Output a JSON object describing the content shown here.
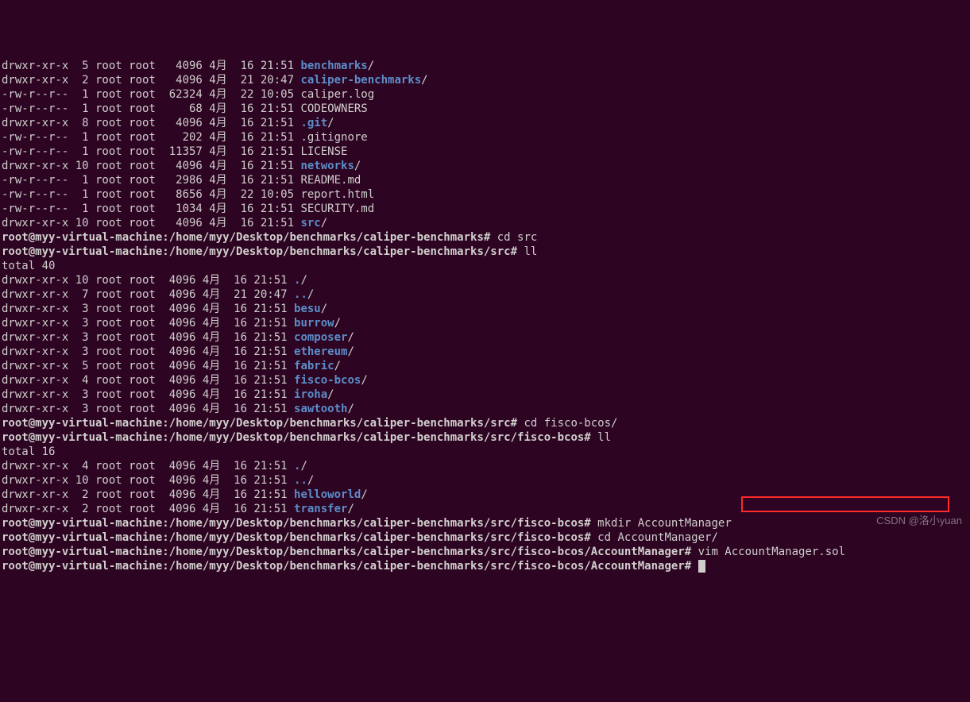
{
  "listing1": [
    {
      "perm": "drwxr-xr-x",
      "ln": " 5",
      "own": "root root",
      "size": "  4096",
      "date": "4月  16 21:51",
      "name": "benchmarks",
      "type": "dir"
    },
    {
      "perm": "drwxr-xr-x",
      "ln": " 2",
      "own": "root root",
      "size": "  4096",
      "date": "4月  21 20:47",
      "name": "caliper-benchmarks",
      "type": "dir"
    },
    {
      "perm": "-rw-r--r--",
      "ln": " 1",
      "own": "root root",
      "size": " 62324",
      "date": "4月  22 10:05",
      "name": "caliper.log",
      "type": "file"
    },
    {
      "perm": "-rw-r--r--",
      "ln": " 1",
      "own": "root root",
      "size": "    68",
      "date": "4月  16 21:51",
      "name": "CODEOWNERS",
      "type": "file"
    },
    {
      "perm": "drwxr-xr-x",
      "ln": " 8",
      "own": "root root",
      "size": "  4096",
      "date": "4月  16 21:51",
      "name": ".git",
      "type": "dir"
    },
    {
      "perm": "-rw-r--r--",
      "ln": " 1",
      "own": "root root",
      "size": "   202",
      "date": "4月  16 21:51",
      "name": ".gitignore",
      "type": "file"
    },
    {
      "perm": "-rw-r--r--",
      "ln": " 1",
      "own": "root root",
      "size": " 11357",
      "date": "4月  16 21:51",
      "name": "LICENSE",
      "type": "file"
    },
    {
      "perm": "drwxr-xr-x",
      "ln": "10",
      "own": "root root",
      "size": "  4096",
      "date": "4月  16 21:51",
      "name": "networks",
      "type": "dir"
    },
    {
      "perm": "-rw-r--r--",
      "ln": " 1",
      "own": "root root",
      "size": "  2986",
      "date": "4月  16 21:51",
      "name": "README.md",
      "type": "file"
    },
    {
      "perm": "-rw-r--r--",
      "ln": " 1",
      "own": "root root",
      "size": "  8656",
      "date": "4月  22 10:05",
      "name": "report.html",
      "type": "file"
    },
    {
      "perm": "-rw-r--r--",
      "ln": " 1",
      "own": "root root",
      "size": "  1034",
      "date": "4月  16 21:51",
      "name": "SECURITY.md",
      "type": "file"
    },
    {
      "perm": "drwxr-xr-x",
      "ln": "10",
      "own": "root root",
      "size": "  4096",
      "date": "4月  16 21:51",
      "name": "src",
      "type": "dir"
    }
  ],
  "prompt1": {
    "user": "root@myy-virtual-machine",
    "path": ":/home/myy/Desktop/benchmarks/caliper-benchmarks# ",
    "cmd": "cd src"
  },
  "prompt2": {
    "user": "root@myy-virtual-machine",
    "path": ":/home/myy/Desktop/benchmarks/caliper-benchmarks/src# ",
    "cmd": "ll"
  },
  "total2": "total 40",
  "listing2": [
    {
      "perm": "drwxr-xr-x",
      "ln": "10",
      "own": "root root",
      "size": " 4096",
      "date": "4月  16 21:51",
      "name": ".",
      "type": "dir"
    },
    {
      "perm": "drwxr-xr-x",
      "ln": " 7",
      "own": "root root",
      "size": " 4096",
      "date": "4月  21 20:47",
      "name": "..",
      "type": "dir"
    },
    {
      "perm": "drwxr-xr-x",
      "ln": " 3",
      "own": "root root",
      "size": " 4096",
      "date": "4月  16 21:51",
      "name": "besu",
      "type": "dir"
    },
    {
      "perm": "drwxr-xr-x",
      "ln": " 3",
      "own": "root root",
      "size": " 4096",
      "date": "4月  16 21:51",
      "name": "burrow",
      "type": "dir"
    },
    {
      "perm": "drwxr-xr-x",
      "ln": " 3",
      "own": "root root",
      "size": " 4096",
      "date": "4月  16 21:51",
      "name": "composer",
      "type": "dir"
    },
    {
      "perm": "drwxr-xr-x",
      "ln": " 3",
      "own": "root root",
      "size": " 4096",
      "date": "4月  16 21:51",
      "name": "ethereum",
      "type": "dir"
    },
    {
      "perm": "drwxr-xr-x",
      "ln": " 5",
      "own": "root root",
      "size": " 4096",
      "date": "4月  16 21:51",
      "name": "fabric",
      "type": "dir"
    },
    {
      "perm": "drwxr-xr-x",
      "ln": " 4",
      "own": "root root",
      "size": " 4096",
      "date": "4月  16 21:51",
      "name": "fisco-bcos",
      "type": "dir"
    },
    {
      "perm": "drwxr-xr-x",
      "ln": " 3",
      "own": "root root",
      "size": " 4096",
      "date": "4月  16 21:51",
      "name": "iroha",
      "type": "dir"
    },
    {
      "perm": "drwxr-xr-x",
      "ln": " 3",
      "own": "root root",
      "size": " 4096",
      "date": "4月  16 21:51",
      "name": "sawtooth",
      "type": "dir"
    }
  ],
  "prompt3": {
    "user": "root@myy-virtual-machine",
    "path": ":/home/myy/Desktop/benchmarks/caliper-benchmarks/src# ",
    "cmd": "cd fisco-bcos/"
  },
  "prompt4": {
    "user": "root@myy-virtual-machine",
    "path": ":/home/myy/Desktop/benchmarks/caliper-benchmarks/src/fisco-bcos# ",
    "cmd": "ll"
  },
  "total3": "total 16",
  "listing3": [
    {
      "perm": "drwxr-xr-x",
      "ln": " 4",
      "own": "root root",
      "size": " 4096",
      "date": "4月  16 21:51",
      "name": ".",
      "type": "dir"
    },
    {
      "perm": "drwxr-xr-x",
      "ln": "10",
      "own": "root root",
      "size": " 4096",
      "date": "4月  16 21:51",
      "name": "..",
      "type": "dir"
    },
    {
      "perm": "drwxr-xr-x",
      "ln": " 2",
      "own": "root root",
      "size": " 4096",
      "date": "4月  16 21:51",
      "name": "helloworld",
      "type": "dir"
    },
    {
      "perm": "drwxr-xr-x",
      "ln": " 2",
      "own": "root root",
      "size": " 4096",
      "date": "4月  16 21:51",
      "name": "transfer",
      "type": "dir"
    }
  ],
  "prompt5": {
    "user": "root@myy-virtual-machine",
    "path": ":/home/myy/Desktop/benchmarks/caliper-benchmarks/src/fisco-bcos# ",
    "cmd": "mkdir AccountManager"
  },
  "prompt6": {
    "user": "root@myy-virtual-machine",
    "path": ":/home/myy/Desktop/benchmarks/caliper-benchmarks/src/fisco-bcos# ",
    "cmd": "cd AccountManager/"
  },
  "prompt7": {
    "user": "root@myy-virtual-machine",
    "path": ":/home/myy/Desktop/benchmarks/caliper-benchmarks/src/fisco-bcos/AccountManager# ",
    "cmd": "vim AccountManager.sol"
  },
  "prompt8": {
    "user": "root@myy-virtual-machine",
    "path": ":/home/myy/Desktop/benchmarks/caliper-benchmarks/src/fisco-bcos/AccountManager# ",
    "cmd": ""
  },
  "watermark": "CSDN @洛小yuan"
}
